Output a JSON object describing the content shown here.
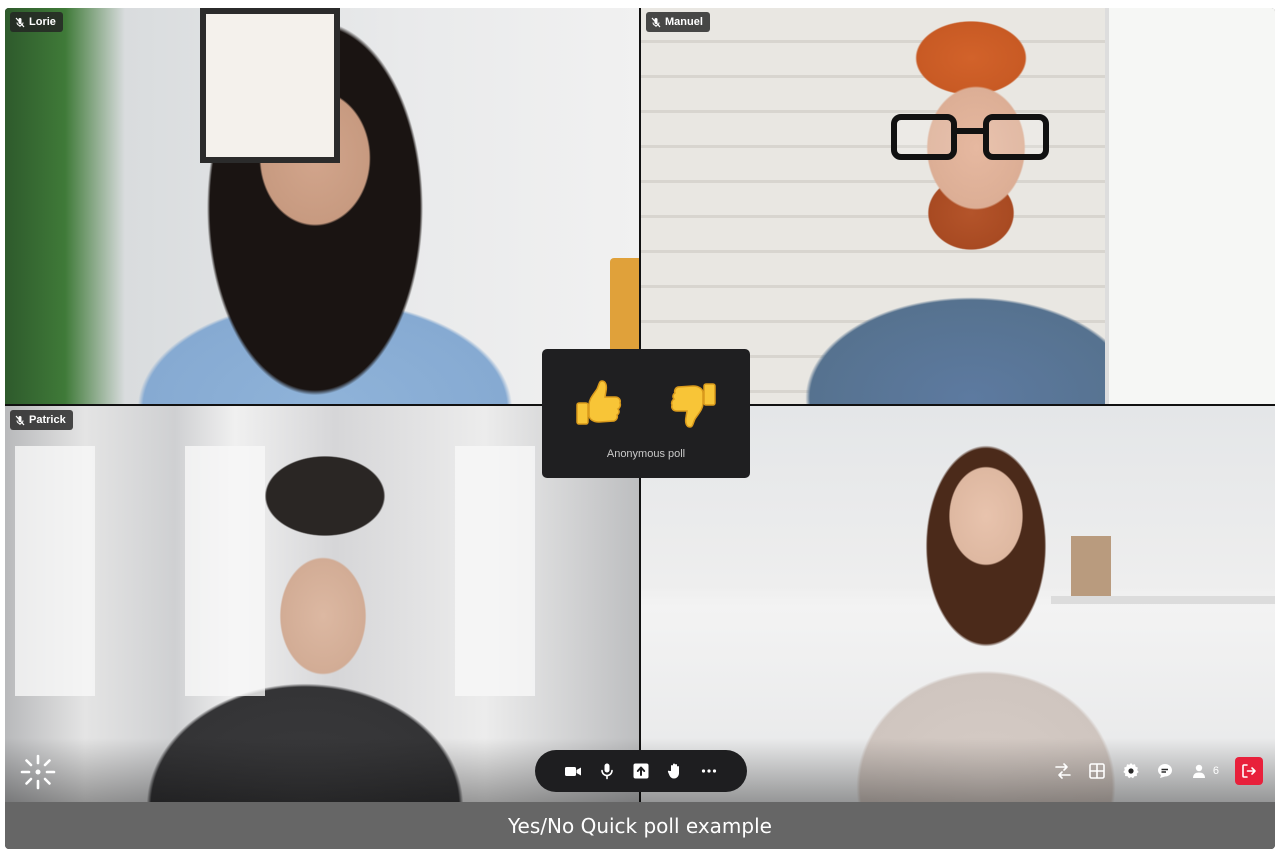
{
  "participants": [
    {
      "name": "Lorie",
      "muted": true
    },
    {
      "name": "Manuel",
      "muted": true
    },
    {
      "name": "Patrick",
      "muted": true
    },
    {
      "name": "",
      "muted": false
    }
  ],
  "poll": {
    "options": [
      {
        "icon": "thumbs-up-icon"
      },
      {
        "icon": "thumbs-down-icon"
      }
    ],
    "label": "Anonymous poll"
  },
  "toolbar": {
    "buttons": [
      "video-camera-icon",
      "microphone-icon",
      "share-screen-icon",
      "raise-hand-icon",
      "more-options-icon"
    ]
  },
  "right_tools": {
    "buttons": [
      "switch-icon",
      "grid-layout-icon",
      "settings-gear-icon",
      "chat-icon",
      "participants-icon",
      "leave-icon"
    ],
    "participant_count": "6"
  },
  "caption": "Yes/No Quick poll example",
  "colors": {
    "leave": "#e8203b",
    "caption_bar": "#666666",
    "toolbar_bg": "#1e1e20",
    "poll_bg": "#1f1f21"
  }
}
